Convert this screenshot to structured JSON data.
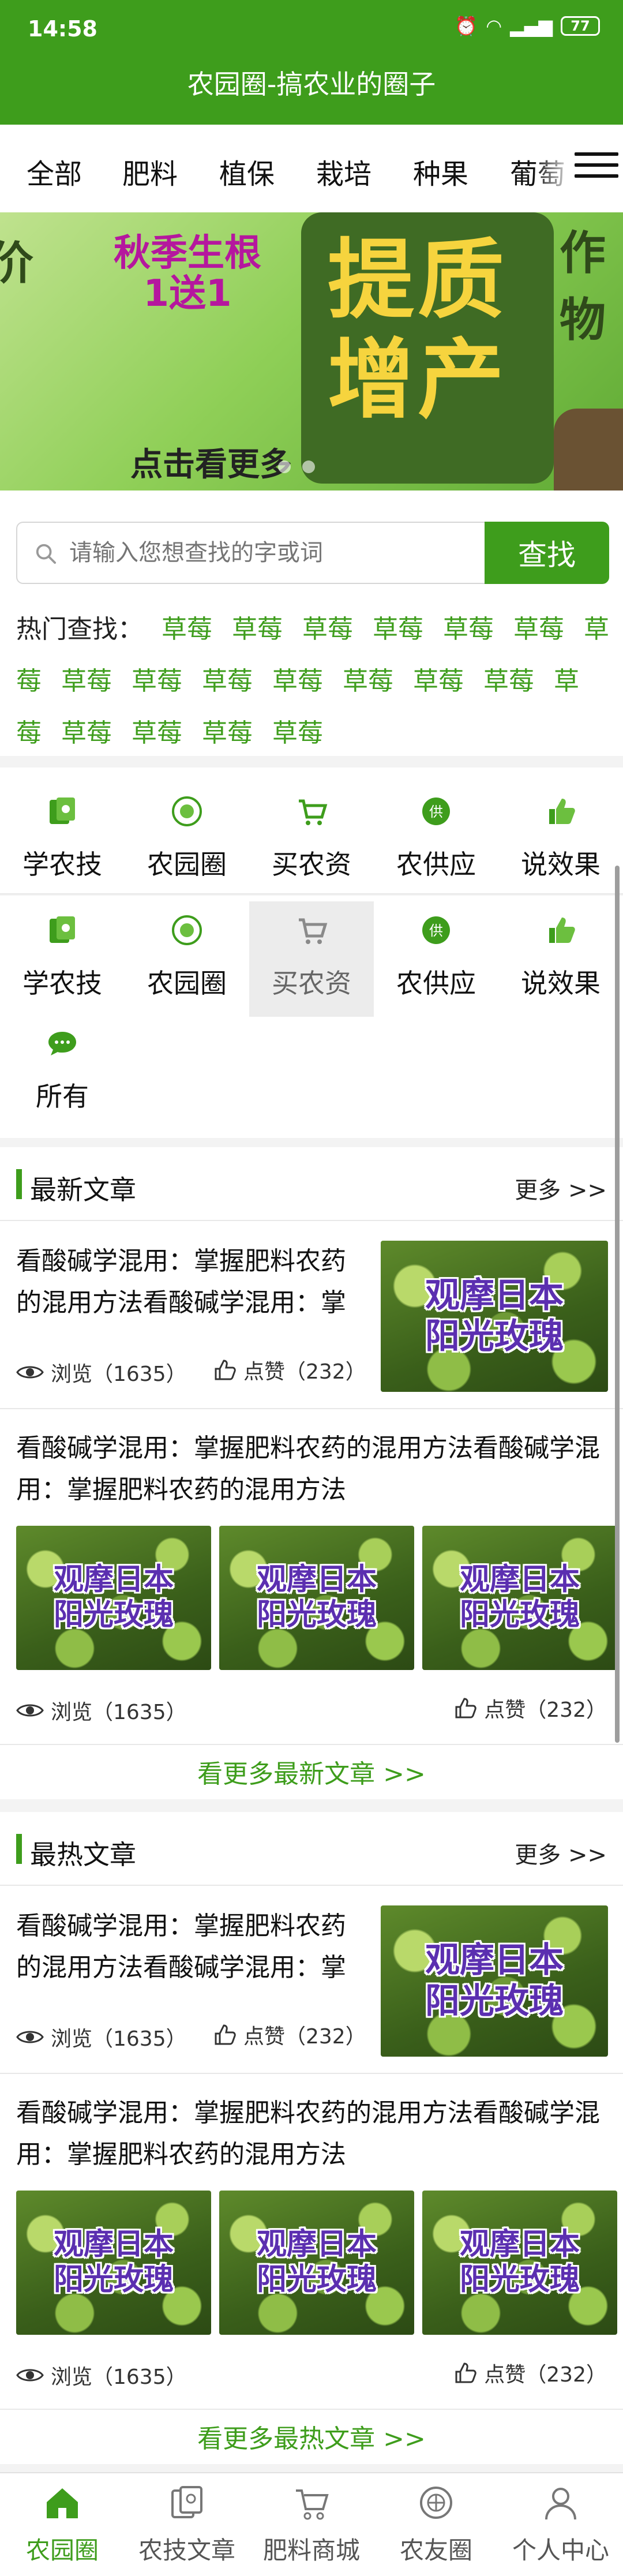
{
  "status_bar": {
    "time": "14:58",
    "battery": "77"
  },
  "app": {
    "title": "农园圈-搞农业的圈子"
  },
  "categories": [
    "全部",
    "肥料",
    "植保",
    "栽培",
    "种果",
    "葡萄"
  ],
  "banner": {
    "left_text": "价",
    "promo_line1": "秋季生根",
    "promo_line2": "1送1",
    "big_line1": "提质",
    "big_line2": "增产",
    "right_text": "作物",
    "cta": "点击看更多"
  },
  "search": {
    "placeholder": "请输入您想查找的字或词",
    "button": "查找",
    "hot_label": "热门查找：",
    "hot_tags": [
      "草莓",
      "草莓",
      "草莓",
      "草莓",
      "草莓",
      "草莓",
      "草莓",
      "草莓",
      "草莓",
      "草莓",
      "草莓",
      "草莓",
      "草莓",
      "草莓",
      "草莓",
      "草莓",
      "草莓",
      "草莓",
      "草莓"
    ]
  },
  "quick_links_1": [
    "学农技",
    "农园圈",
    "买农资",
    "农供应",
    "说效果"
  ],
  "quick_links_2": [
    "学农技",
    "农园圈",
    "买农资",
    "农供应",
    "说效果",
    "所有"
  ],
  "icon_colors": {
    "green": "#3e9d1c",
    "gray": "#8a8a8a",
    "theme": "#3e9d1c"
  },
  "latest": {
    "title": "最新文章",
    "more": "更多 >>",
    "article1": {
      "title": "看酸碱学混用：掌握肥料农药的混用方法看酸碱学混用：掌握肥料农药的混用方法",
      "views": "浏览（1635）",
      "likes": "点赞（232）",
      "image_caption": "观摩日本\n阳光玫瑰"
    },
    "article2": {
      "title": "看酸碱学混用：掌握肥料农药的混用方法看酸碱学混用：掌握肥料农药的混用方法",
      "views": "浏览（1635）",
      "likes": "点赞（232）",
      "image_caption": "观摩日本\n阳光玫瑰"
    },
    "see_more": "看更多最新文章 >>"
  },
  "hottest": {
    "title": "最热文章",
    "more": "更多 >>",
    "article1": {
      "title": "看酸碱学混用：掌握肥料农药的混用方法看酸碱学混用：掌握肥料农药的混用方法",
      "views": "浏览（1635）",
      "likes": "点赞（232）",
      "image_caption": "观摩日本\n阳光玫瑰"
    },
    "article2": {
      "title": "看酸碱学混用：掌握肥料农药的混用方法看酸碱学混用：掌握肥料农药的混用方法",
      "views": "浏览（1635）",
      "likes": "点赞（232）",
      "image_caption": "观摩日本\n阳光玫瑰"
    },
    "see_more": "看更多最热文章 >>"
  },
  "tabs": [
    "农园圈",
    "农技文章",
    "肥料商城",
    "农友圈",
    "个人中心"
  ]
}
